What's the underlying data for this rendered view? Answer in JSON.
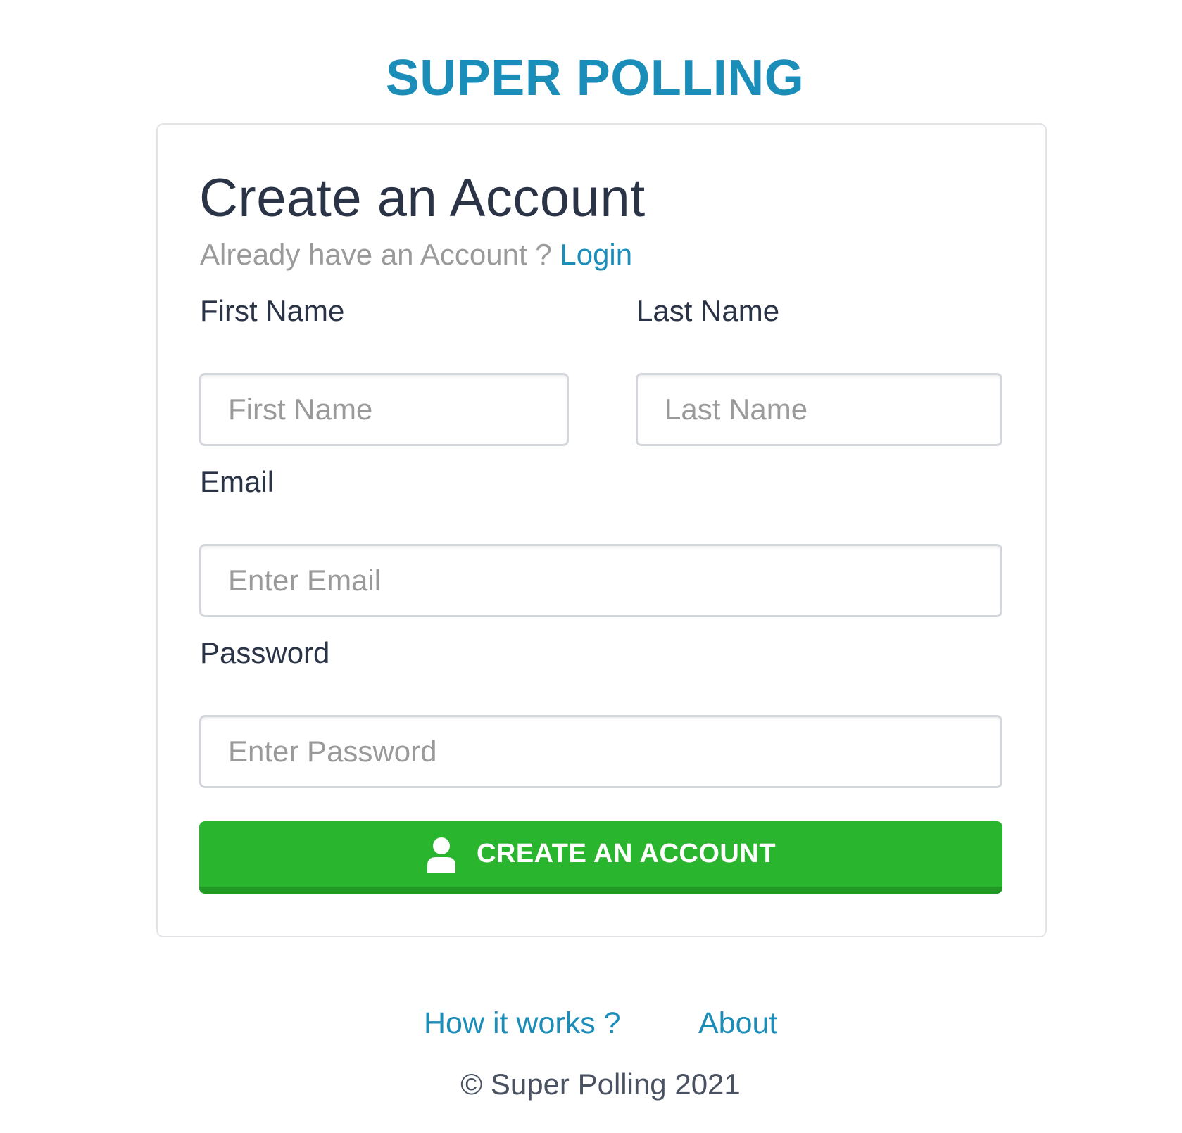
{
  "header": {
    "brand": "SUPER POLLING"
  },
  "card": {
    "title": "Create an Account",
    "subtitle_prefix": "Already have an Account ?",
    "login_link": "Login"
  },
  "form": {
    "first_name": {
      "label": "First Name",
      "placeholder": "First Name",
      "value": ""
    },
    "last_name": {
      "label": "Last Name",
      "placeholder": "Last Name",
      "value": ""
    },
    "email": {
      "label": "Email",
      "placeholder": "Enter Email",
      "value": ""
    },
    "password": {
      "label": "Password",
      "placeholder": "Enter Password",
      "value": ""
    },
    "submit": {
      "label": "CREATE AN ACCOUNT",
      "icon": "user-icon"
    }
  },
  "footer": {
    "links": [
      "How it works ?",
      "About"
    ],
    "copyright": "© Super Polling 2021"
  },
  "colors": {
    "brand": "#1b8db9",
    "button": "#2ab52e",
    "button_shadow": "#219a25",
    "heading": "#2b3446",
    "muted": "#9a9a9a",
    "border": "#d3d6db"
  }
}
